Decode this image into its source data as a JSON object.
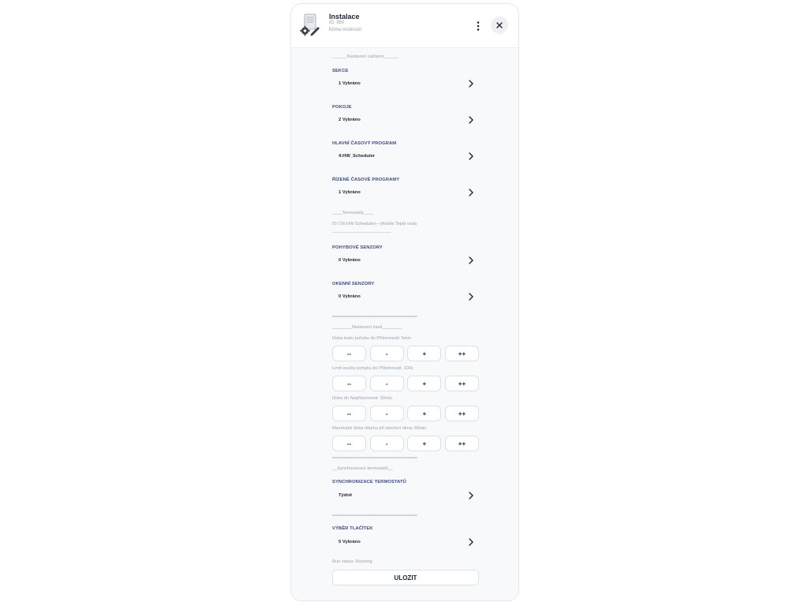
{
  "header": {
    "title": "Instalace",
    "id": "ID: 950",
    "room": "Klima místností",
    "menu_icon": "kebab-menu-icon",
    "close_icon": "close-icon",
    "device_icon": "device-settings-icon"
  },
  "notes": {
    "device_settings": "______Nastavení zařízení______",
    "thermostats": "____Termostaty____",
    "thermostat_entry": "ID:736:HW Scheduler|---|Režim Teplá voda",
    "dash_short": "----------------------------------------",
    "eq_line_1": "=================================",
    "time_settings": "________Nastavení časů________",
    "eq_line_2": "=================================",
    "sync_heading": "__Synchronizace termostatů__",
    "eq_line_3": "================================="
  },
  "sections": {
    "sekce": {
      "label": "SEKCE",
      "value": "1 Vybráno"
    },
    "pokoje": {
      "label": "POKOJE",
      "value": "2 Vybráno"
    },
    "hlavni": {
      "label": "HLAVNÍ ČASOVÝ PROGRAM",
      "value": "4:HW_Scheduler"
    },
    "rizene": {
      "label": "ŘÍZENÉ ČASOVÉ PROGRAMY",
      "value": "1 Vybráno"
    },
    "pohyb": {
      "label": "POHYBOVÉ SENZORY",
      "value": "0 Vybráno"
    },
    "okenni": {
      "label": "OKENNÍ SENZORY",
      "value": "0 Vybráno"
    },
    "sync": {
      "label": "SYNCHRONIZACE TERMOSTATŮ",
      "value": "Týdně"
    },
    "tlacitka": {
      "label": "VÝBĚR TLAČÍTEK",
      "value": "5 Vybráno"
    }
  },
  "steppers": [
    {
      "label": "Doba testu pohybu do Přítomnosti: 5min",
      "buttons": [
        "--",
        "-",
        "+",
        "++"
      ]
    },
    {
      "label": "Limit součtu pohybu do Přítomnosti: 100s",
      "buttons": [
        "--",
        "-",
        "+",
        "++"
      ]
    },
    {
      "label": "Doba do Nepřítomnosti: 30min",
      "buttons": [
        "--",
        "-",
        "+",
        "++"
      ]
    },
    {
      "label": "Maximální doba útlumu při otevření okna: 60min",
      "buttons": [
        "--",
        "-",
        "+",
        "++"
      ]
    }
  ],
  "footer": {
    "run_status": "Run status: Running",
    "save_label": "ULOZIT"
  },
  "colors": {
    "section_label": "#3c4a8c",
    "text": "#1d2433",
    "muted": "#9aa2af"
  }
}
